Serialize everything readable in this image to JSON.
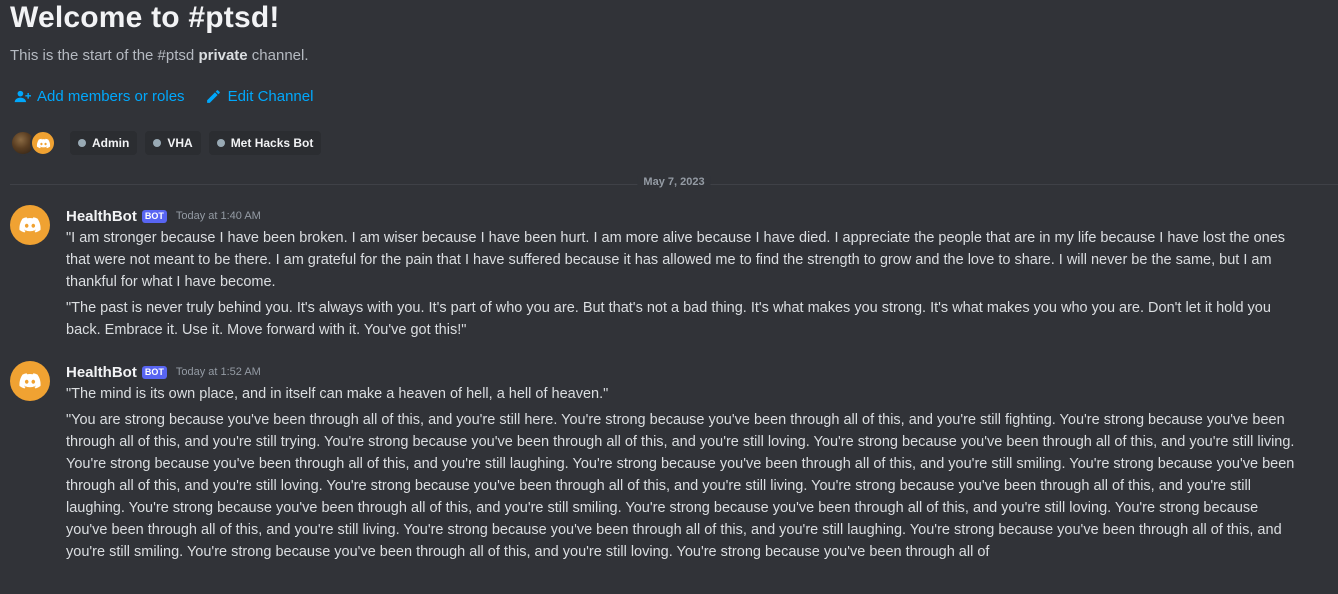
{
  "welcome": {
    "title": "Welcome to #ptsd!",
    "subtitle_prefix": "This is the start of the #ptsd ",
    "subtitle_bold": "private",
    "subtitle_suffix": " channel."
  },
  "actions": {
    "add_members": "Add members or roles",
    "edit_channel": "Edit Channel"
  },
  "roles": [
    "Admin",
    "VHA",
    "Met Hacks Bot"
  ],
  "date_divider": "May 7, 2023",
  "messages": [
    {
      "author": "HealthBot",
      "bot_tag": "BOT",
      "timestamp": "Today at 1:40 AM",
      "lines": [
        "\"I am stronger because I have been broken. I am wiser because I have been hurt. I am more alive because I have died. I appreciate the people that are in my life because I have lost the ones that were not meant to be there. I am grateful for the pain that I have suffered because it has allowed me to find the strength to grow and the love to share. I will never be the same, but I am thankful for what I have become.",
        "\"The past is never truly behind you. It's always with you. It's part of who you are. But that's not a bad thing. It's what makes you strong. It's what makes you who you are. Don't let it hold you back. Embrace it. Use it. Move forward with it. You've got this!\""
      ]
    },
    {
      "author": "HealthBot",
      "bot_tag": "BOT",
      "timestamp": "Today at 1:52 AM",
      "lines": [
        "\"The mind is its own place, and in itself can make a heaven of hell, a hell of heaven.\"",
        "\"You are strong because you've been through all of this, and you're still here. You're strong because you've been through all of this, and you're still fighting. You're strong because you've been through all of this, and you're still trying. You're strong because you've been through all of this, and you're still loving. You're strong because you've been through all of this, and you're still living. You're strong because you've been through all of this, and you're still laughing. You're strong because you've been through all of this, and you're still smiling. You're strong because you've been through all of this, and you're still loving. You're strong because you've been through all of this, and you're still living. You're strong because you've been through all of this, and you're still laughing. You're strong because you've been through all of this, and you're still smiling. You're strong because you've been through all of this, and you're still loving. You're strong because you've been through all of this, and you're still living. You're strong because you've been through all of this, and you're still laughing. You're strong because you've been through all of this, and you're still smiling. You're strong because you've been through all of this, and you're still loving. You're strong because you've been through all of"
      ]
    }
  ]
}
